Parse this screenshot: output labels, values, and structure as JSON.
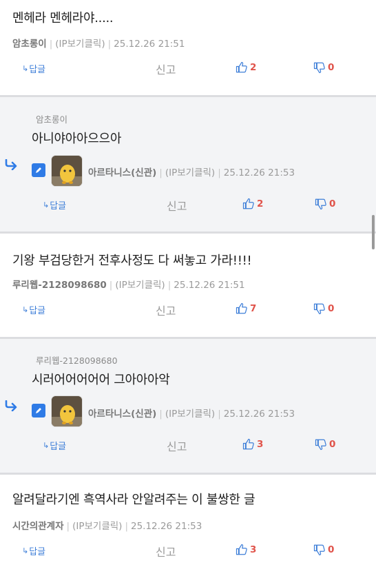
{
  "comments": [
    {
      "type": "top",
      "text": "멘헤라 멘헤라야.....",
      "author": "암초롱이",
      "ip": "(IP보기클릭)",
      "datetime": "25.12.26 21:51",
      "reply_label": "답글",
      "report_label": "신고",
      "likes": "2",
      "dislikes": "0"
    },
    {
      "type": "reply",
      "reply_to": "암초롱이",
      "text": "아니야아아으으아",
      "author": "아르타니스(신관)",
      "ip": "(IP보기클릭)",
      "datetime": "25.12.26 21:53",
      "reply_label": "답글",
      "report_label": "신고",
      "likes": "2",
      "dislikes": "0"
    },
    {
      "type": "top",
      "text": "기왕 부검당한거 전후사정도 다 써놓고 가라!!!!",
      "author": "루리웹-2128098680",
      "ip": "(IP보기클릭)",
      "datetime": "25.12.26 21:51",
      "reply_label": "답글",
      "report_label": "신고",
      "likes": "7",
      "dislikes": "0"
    },
    {
      "type": "reply",
      "reply_to": "루리웹-2128098680",
      "text": "시러어어어어어 그아아아악",
      "author": "아르타니스(신관)",
      "ip": "(IP보기클릭)",
      "datetime": "25.12.26 21:53",
      "reply_label": "답글",
      "report_label": "신고",
      "likes": "3",
      "dislikes": "0"
    },
    {
      "type": "top",
      "text": "알려달라기엔 흑역사라 안알려주는 이 불쌍한 글",
      "author": "시간의관계자",
      "ip": "(IP보기클릭)",
      "datetime": "25.12.26 21:53",
      "reply_label": "답글",
      "report_label": "신고",
      "likes": "3",
      "dislikes": "0"
    }
  ],
  "colors": {
    "accent": "#3d7ed8",
    "count": "#e0534a",
    "reply_background": "#f3f4f6",
    "edit_badge": "#2f7be6"
  },
  "icons": {
    "reply_action": "reply-arrow-icon",
    "like": "thumbs-up-icon",
    "dislike": "thumbs-down-icon",
    "reply_marker": "reply-indent-arrow-icon",
    "edit": "pencil-icon"
  }
}
